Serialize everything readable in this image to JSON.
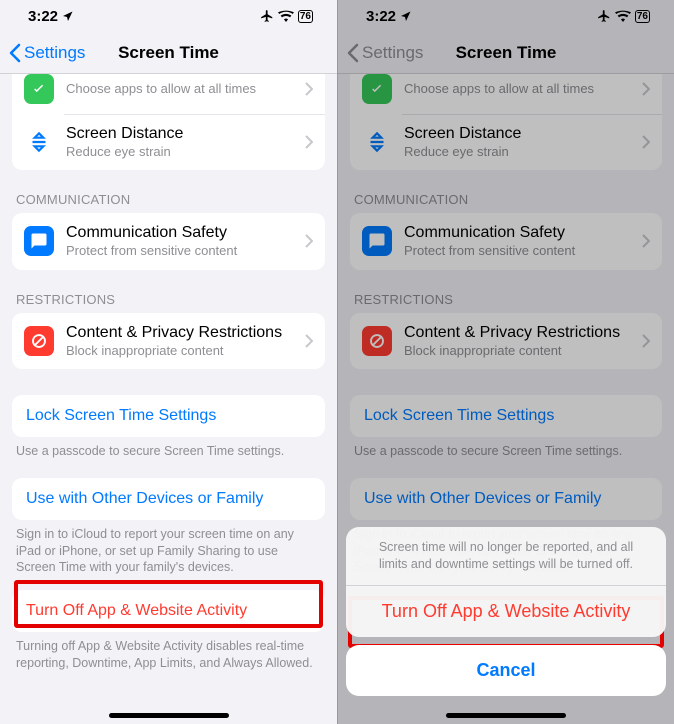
{
  "status": {
    "time": "3:22",
    "battery": "76"
  },
  "nav": {
    "back": "Settings",
    "title": "Screen Time"
  },
  "rows": {
    "always_sub": "Choose apps to allow at all times",
    "distance_title": "Screen Distance",
    "distance_sub": "Reduce eye strain",
    "comm_title": "Communication Safety",
    "comm_sub": "Protect from sensitive content",
    "contres_title": "Content & Privacy Restrictions",
    "contres_sub": "Block inappropriate content"
  },
  "headers": {
    "communication": "COMMUNICATION",
    "restrictions": "RESTRICTIONS"
  },
  "links": {
    "lock": "Lock Screen Time Settings",
    "lock_footer": "Use a passcode to secure Screen Time settings.",
    "family": "Use with Other Devices or Family",
    "family_footer": "Sign in to iCloud to report your screen time on any iPad or iPhone, or set up Family Sharing to use Screen Time with your family's devices.",
    "turnoff": "Turn Off App & Website Activity",
    "turnoff_footer": "Turning off App & Website Activity disables real-time reporting, Downtime, App Limits, and Always Allowed."
  },
  "sheet": {
    "message": "Screen time will no longer be reported, and all limits and downtime settings will be turned off.",
    "turnoff": "Turn Off App & Website Activity",
    "cancel": "Cancel"
  },
  "colors": {
    "green": "#34c759",
    "blue_icon": "#007aff",
    "red_icon": "#ff3b30"
  }
}
